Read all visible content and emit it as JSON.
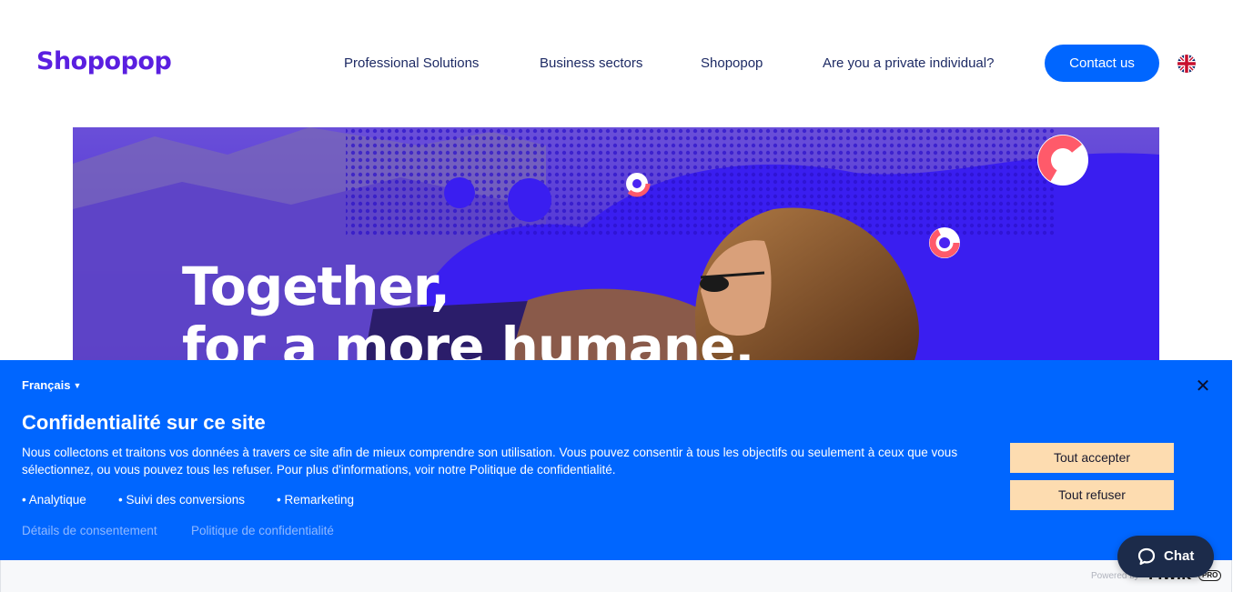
{
  "header": {
    "logo_text": "Shopopop",
    "nav": [
      {
        "label": "Professional Solutions"
      },
      {
        "label": "Business sectors"
      },
      {
        "label": "Shopopop"
      },
      {
        "label": "Are you a private individual?"
      }
    ],
    "contact_label": "Contact us",
    "language_icon": "uk-flag-icon"
  },
  "hero": {
    "title_line1": "Together,",
    "title_line2": "for a more humane,"
  },
  "cookie_banner": {
    "language": "Français",
    "title": "Confidentialité sur ce site",
    "text": "Nous collectons et traitons vos données à travers ce site afin de mieux comprendre son utilisation. Vous pouvez consentir à tous les objectifs ou seulement à ceux que vous sélectionnez, ou vous pouvez tous les refuser. Pour plus d'informations, voir notre Politique de confidentialité.",
    "purposes": [
      "• Analytique",
      "• Suivi des conversions",
      "• Remarketing"
    ],
    "links": [
      "Détails de consentement",
      "Politique de confidentialité"
    ],
    "accept_label": "Tout accepter",
    "refuse_label": "Tout refuser",
    "close_icon": "close-icon"
  },
  "footer": {
    "powered_by": "Powered by",
    "piwik": "PIWIK",
    "piwik_pro": "PRO"
  },
  "chat": {
    "label": "Chat",
    "icon": "chat-bubble-icon"
  },
  "colors": {
    "brand_purple": "#5a1fe0",
    "primary_blue": "#0066ff",
    "nav_text": "#1d2a64",
    "cookie_button": "#fddcb0",
    "chat_button": "#1c2b4a",
    "hero_accent": "#ff5a6a"
  }
}
